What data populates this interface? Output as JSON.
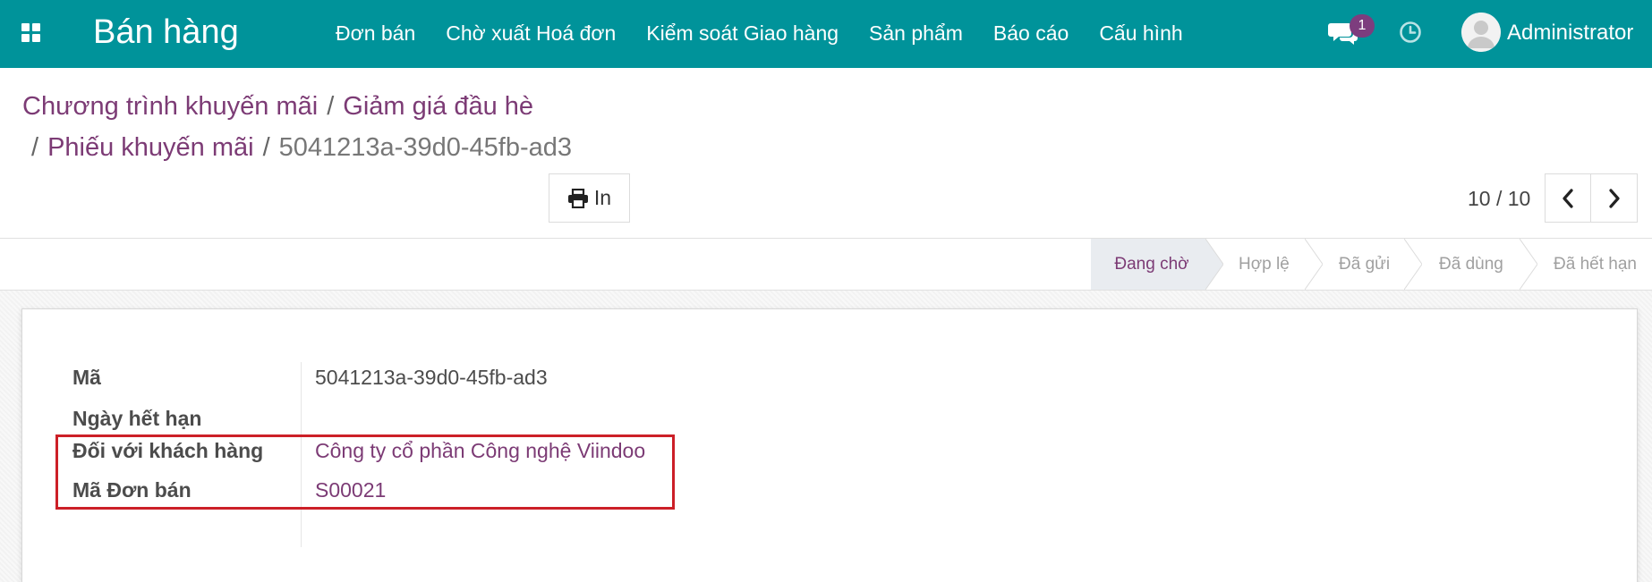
{
  "navbar": {
    "brand": "Bán hàng",
    "menu": [
      "Đơn bán",
      "Chờ xuất Hoá đơn",
      "Kiểm soát Giao hàng",
      "Sản phẩm",
      "Báo cáo",
      "Cấu hình"
    ],
    "chat_badge": "1",
    "username": "Administrator",
    "icons": {
      "apps": "apps-grid-icon",
      "chat": "chat-icon",
      "activity": "clock-icon",
      "avatar": "user-avatar"
    }
  },
  "breadcrumb": {
    "items": [
      "Chương trình khuyến mãi",
      "Giảm giá đầu hè",
      "Phiếu khuyến mãi"
    ],
    "current": "5041213a-39d0-45fb-ad3",
    "separator": "/"
  },
  "toolbar": {
    "print_label": "In"
  },
  "pager": {
    "value": "10 / 10"
  },
  "status": {
    "stages": [
      "Đang chờ",
      "Hợp lệ",
      "Đã gửi",
      "Đã dùng",
      "Đã hết hạn"
    ],
    "active": "Đang chờ"
  },
  "form": {
    "fields": [
      {
        "label": "Mã",
        "value": "5041213a-39d0-45fb-ad3"
      },
      {
        "label": "Ngày hết hạn",
        "value": ""
      },
      {
        "label": "Đối với khách hàng",
        "value": "Công ty cổ phần Công nghệ Viindoo"
      },
      {
        "label": "Mã Đơn bán",
        "value": "S00021"
      }
    ]
  },
  "colors": {
    "navbar": "#00939a",
    "link": "#7c3b75",
    "badge": "#7d3d7e",
    "highlight": "#cc1f27"
  }
}
